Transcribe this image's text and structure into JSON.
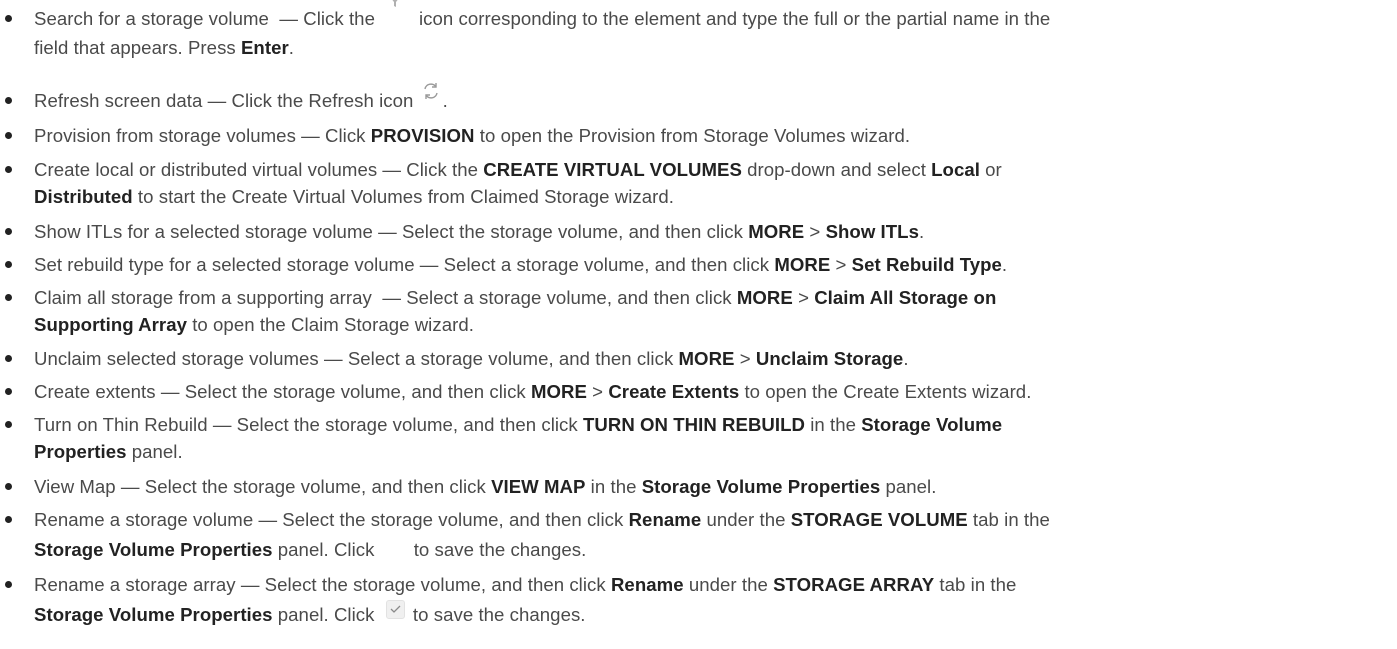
{
  "items": [
    {
      "lines": [
        [
          "Search for a storage volume  — Click the",
          {
            "icon": "filter-icon"
          },
          "icon corresponding to the element and type the full or the partial name in the"
        ],
        [
          "field that appears. Press ",
          {
            "b": "Enter"
          },
          "."
        ]
      ]
    },
    {
      "lines": [
        [
          "Refresh screen data — Click the Refresh icon ",
          {
            "icon": "refresh-icon"
          },
          "."
        ]
      ]
    },
    {
      "lines": [
        [
          "Provision from storage volumes — Click ",
          {
            "b": "PROVISION"
          },
          " to open the Provision from Storage Volumes wizard."
        ]
      ]
    },
    {
      "lines": [
        [
          "Create local or distributed virtual volumes — Click the ",
          {
            "b": "CREATE VIRTUAL VOLUMES"
          },
          " drop-down and select ",
          {
            "b": "Local"
          },
          " or"
        ],
        [
          {
            "b": "Distributed"
          },
          " to start the Create Virtual Volumes from Claimed Storage wizard."
        ]
      ]
    },
    {
      "lines": [
        [
          "Show ITLs for a selected storage volume — Select the storage volume, and then click ",
          {
            "b": "MORE"
          },
          " > ",
          {
            "b": "Show ITLs"
          },
          "."
        ]
      ]
    },
    {
      "lines": [
        [
          "Set rebuild type for a selected storage volume — Select a storage volume, and then click ",
          {
            "b": "MORE"
          },
          " > ",
          {
            "b": "Set Rebuild Type"
          },
          "."
        ]
      ]
    },
    {
      "lines": [
        [
          "Claim all storage from a supporting array  — Select a storage volume, and then click ",
          {
            "b": "MORE"
          },
          " > ",
          {
            "b": "Claim All Storage on"
          }
        ],
        [
          {
            "b": "Supporting Array"
          },
          " to open the Claim Storage wizard."
        ]
      ]
    },
    {
      "lines": [
        [
          "Unclaim selected storage volumes — Select a storage volume, and then click ",
          {
            "b": "MORE"
          },
          " > ",
          {
            "b": "Unclaim Storage"
          },
          "."
        ]
      ]
    },
    {
      "lines": [
        [
          "Create extents — Select the storage volume, and then click ",
          {
            "b": "MORE"
          },
          " > ",
          {
            "b": "Create Extents"
          },
          " to open the Create Extents wizard."
        ]
      ]
    },
    {
      "lines": [
        [
          "Turn on Thin Rebuild — Select the storage volume, and then click ",
          {
            "b": "TURN ON THIN REBUILD"
          },
          " in the ",
          {
            "b": "Storage Volume"
          }
        ],
        [
          {
            "b": "Properties"
          },
          " panel."
        ]
      ]
    },
    {
      "lines": [
        [
          "View Map — Select the storage volume, and then click ",
          {
            "b": "VIEW MAP"
          },
          " in the ",
          {
            "b": "Storage Volume Properties"
          },
          " panel."
        ]
      ]
    },
    {
      "lines": [
        [
          "Rename a storage volume — Select the storage volume, and then click ",
          {
            "b": "Rename"
          },
          " under the ",
          {
            "b": "STORAGE VOLUME"
          },
          " tab in the"
        ],
        [
          {
            "b": "Storage Volume Properties"
          },
          " panel. Click ",
          {
            "icon": "check-space"
          },
          "to save the changes."
        ]
      ]
    },
    {
      "lines": [
        [
          "Rename a storage array — Select the storage volume, and then click ",
          {
            "b": "Rename"
          },
          " under the ",
          {
            "b": "STORAGE ARRAY"
          },
          " tab in the"
        ],
        [
          {
            "b": "Storage Volume Properties"
          },
          " panel. Click ",
          {
            "icon": "check-icon"
          },
          " to save the changes."
        ]
      ]
    }
  ]
}
